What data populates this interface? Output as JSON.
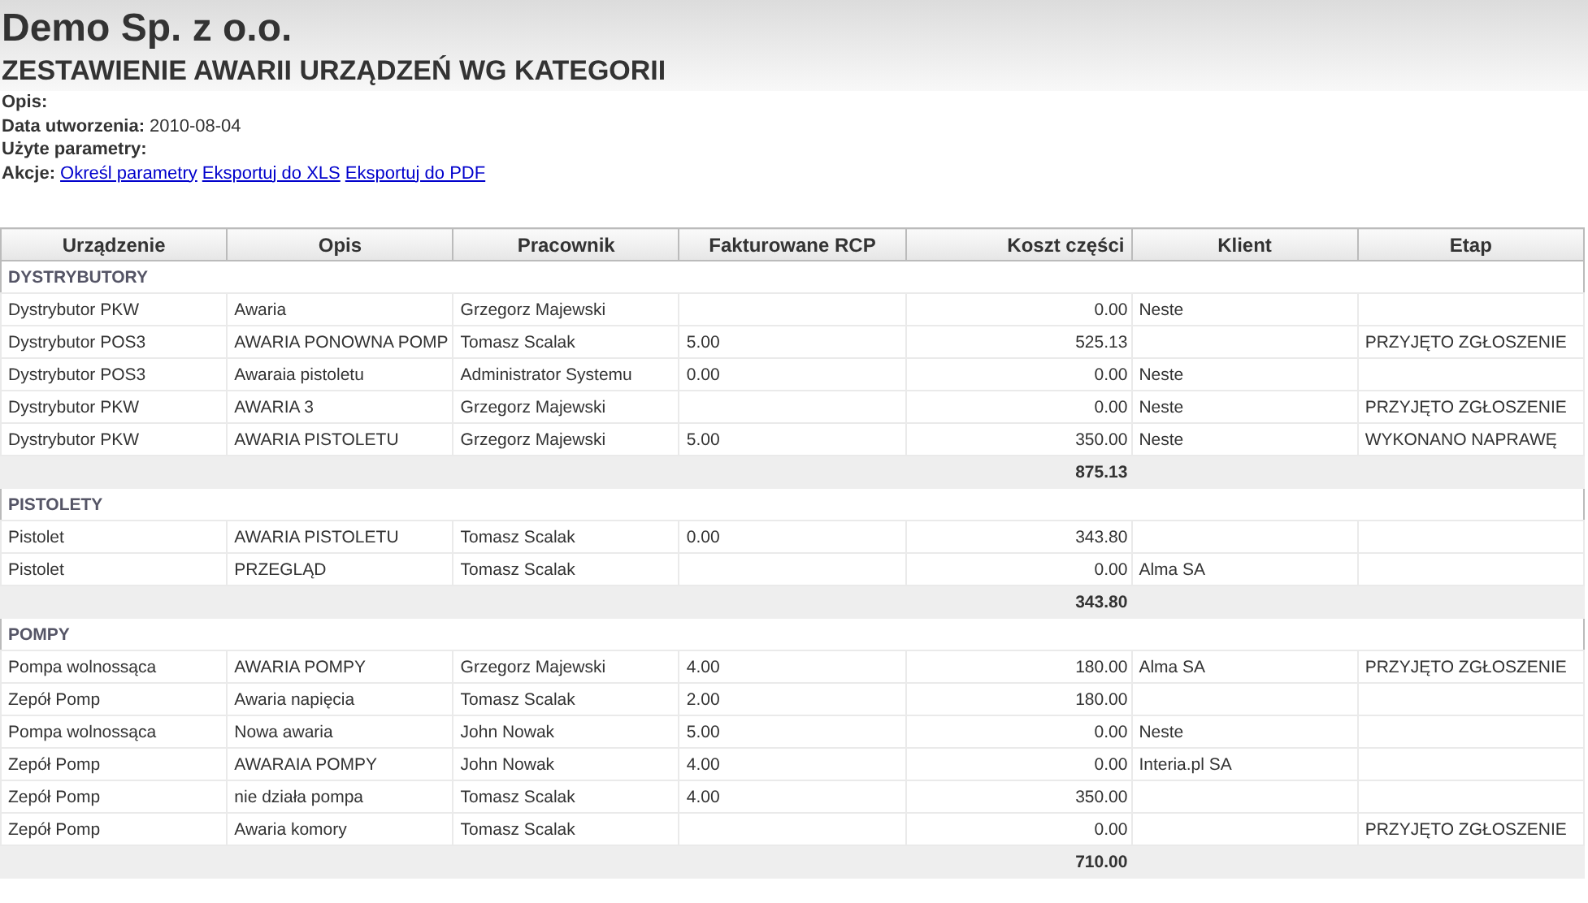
{
  "company": "Demo Sp. z o.o.",
  "report_title": "ZESTAWIENIE AWARII URZĄDZEŃ WG KATEGORII",
  "info": [
    {
      "label": "Opis:"
    },
    {
      "label": "Data utworzenia:",
      "value": "2010-08-04"
    },
    {
      "label": "Użyte parametry:"
    }
  ],
  "actions": {
    "label": "Akcje:",
    "links": [
      "Określ parametry",
      "Eksportuj do XLS",
      "Eksportuj do PDF"
    ]
  },
  "table": {
    "columns": [
      "Urządzenie",
      "Opis",
      "Pracownik",
      "Fakturowane RCP",
      "Koszt części",
      "Klient",
      "Etap"
    ],
    "groups": [
      {
        "name": "DYSTRYBUTORY",
        "total": "875.13",
        "rows": [
          [
            "Dystrybutor PKW",
            "Awaria",
            "Grzegorz Majewski",
            null,
            "0.00",
            "Neste",
            null
          ],
          [
            "Dystrybutor POS3",
            "AWARIA PONOWNA POMP",
            "Tomasz Scalak",
            "5.00",
            "525.13",
            null,
            "PRZYJĘTO ZGŁOSZENIE"
          ],
          [
            "Dystrybutor POS3",
            "Awaraia pistoletu",
            "Administrator Systemu",
            "0.00",
            "0.00",
            "Neste",
            null
          ],
          [
            "Dystrybutor PKW",
            "AWARIA 3",
            "Grzegorz Majewski",
            null,
            "0.00",
            "Neste",
            "PRZYJĘTO ZGŁOSZENIE"
          ],
          [
            "Dystrybutor PKW",
            "AWARIA PISTOLETU",
            "Grzegorz Majewski",
            "5.00",
            "350.00",
            "Neste",
            "WYKONANO NAPRAWĘ"
          ]
        ]
      },
      {
        "name": "PISTOLETY",
        "total": "343.80",
        "rows": [
          [
            "Pistolet",
            "AWARIA PISTOLETU",
            "Tomasz Scalak",
            "0.00",
            "343.80",
            null,
            null
          ],
          [
            "Pistolet",
            "PRZEGLĄD",
            "Tomasz Scalak",
            null,
            "0.00",
            "Alma SA",
            null
          ]
        ]
      },
      {
        "name": "POMPY",
        "total": "710.00",
        "rows": [
          [
            "Pompa wolnossąca",
            "AWARIA POMPY",
            "Grzegorz Majewski",
            "4.00",
            "180.00",
            "Alma SA",
            "PRZYJĘTO ZGŁOSZENIE"
          ],
          [
            "Zepół Pomp",
            "Awaria napięcia",
            "Tomasz Scalak",
            "2.00",
            "180.00",
            null,
            null
          ],
          [
            "Pompa wolnossąca",
            "Nowa awaria",
            "John Nowak",
            "5.00",
            "0.00",
            "Neste",
            null
          ],
          [
            "Zepół Pomp",
            "AWARAIA POMPY",
            "John Nowak",
            "4.00",
            "0.00",
            "Interia.pl SA",
            null
          ],
          [
            "Zepół Pomp",
            "nie działa pompa",
            "Tomasz Scalak",
            "4.00",
            "350.00",
            null,
            null
          ],
          [
            "Zepół Pomp",
            "Awaria komory",
            "Tomasz Scalak",
            null,
            "0.00",
            null,
            "PRZYJĘTO ZGŁOSZENIE"
          ]
        ]
      }
    ]
  }
}
